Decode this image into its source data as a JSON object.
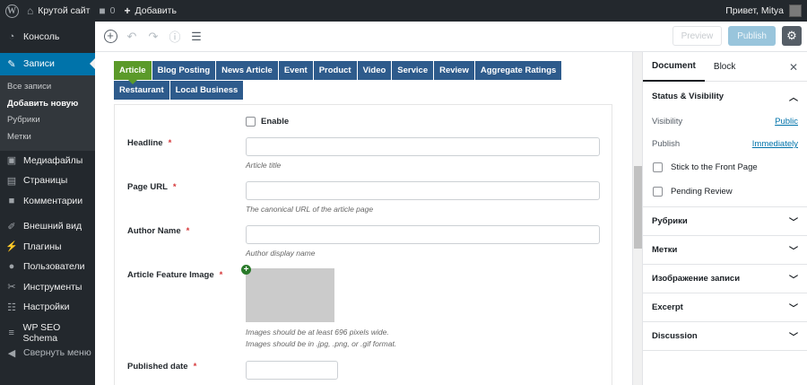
{
  "adminbar": {
    "site_name": "Крутой сайт",
    "comments_count": "0",
    "add_new": "Добавить",
    "greeting": "Привет, Mitya"
  },
  "sidebar": {
    "items": [
      {
        "label": "Консоль",
        "icon": "dashboard-icon"
      },
      {
        "label": "Записи",
        "icon": "pin-icon"
      },
      {
        "label": "Медиафайлы",
        "icon": "media-icon"
      },
      {
        "label": "Страницы",
        "icon": "page-icon"
      },
      {
        "label": "Комментарии",
        "icon": "comment-icon"
      },
      {
        "label": "Внешний вид",
        "icon": "brush-icon"
      },
      {
        "label": "Плагины",
        "icon": "plugin-icon"
      },
      {
        "label": "Пользователи",
        "icon": "user-icon"
      },
      {
        "label": "Инструменты",
        "icon": "wrench-icon"
      },
      {
        "label": "Настройки",
        "icon": "settings-icon"
      },
      {
        "label": "WP SEO Schema",
        "icon": "schema-icon"
      },
      {
        "label": "Свернуть меню",
        "icon": "collapse-icon"
      }
    ],
    "submenu": [
      "Все записи",
      "Добавить новую",
      "Рубрики",
      "Метки"
    ]
  },
  "toolbar": {
    "preview_label": "Preview",
    "publish_label": "Publish"
  },
  "tabs": [
    "Article",
    "Blog Posting",
    "News Article",
    "Event",
    "Product",
    "Video",
    "Service",
    "Review",
    "Aggregate Ratings",
    "Restaurant",
    "Local Business"
  ],
  "form": {
    "enable_label": "Enable",
    "headline": {
      "label": "Headline",
      "required": "*",
      "desc": "Article title"
    },
    "page_url": {
      "label": "Page URL",
      "required": "*",
      "desc": "The canonical URL of the article page"
    },
    "author_name": {
      "label": "Author Name",
      "required": "*",
      "desc": "Author display name"
    },
    "feature_image": {
      "label": "Article Feature Image",
      "required": "*",
      "desc_line1": "Images should be at least 696 pixels wide.",
      "desc_line2": "Images should be in .jpg, .png, or .gif format."
    },
    "published_date": {
      "label": "Published date",
      "required": "*"
    }
  },
  "settings": {
    "tab_document": "Document",
    "tab_block": "Block",
    "status_visibility": "Status & Visibility",
    "visibility_label": "Visibility",
    "visibility_value": "Public",
    "publish_label": "Publish",
    "publish_value": "Immediately",
    "stick_label": "Stick to the Front Page",
    "pending_label": "Pending Review",
    "panels": [
      "Рубрики",
      "Метки",
      "Изображение записи",
      "Excerpt",
      "Discussion"
    ]
  },
  "colors": {
    "admin_dark": "#23282d",
    "accent_blue": "#0073aa",
    "tab_blue": "#2e5b8c",
    "tab_active_green": "#5b9a2a",
    "required_red": "#d63638"
  }
}
